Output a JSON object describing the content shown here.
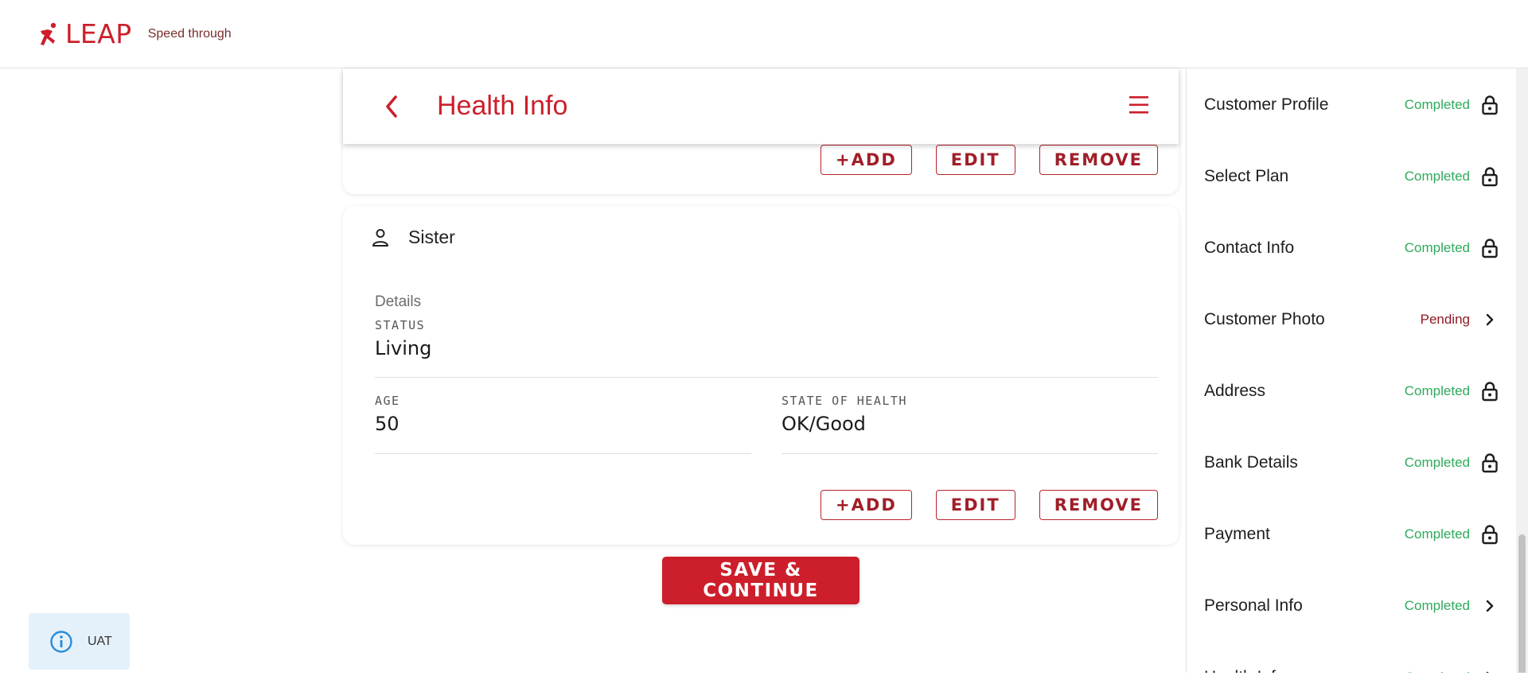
{
  "brand": {
    "name": "LEAP",
    "tagline": "Speed through",
    "color": "#cc1f2b"
  },
  "page": {
    "title": "Health Info"
  },
  "actions": {
    "add": "+ADD",
    "edit": "EDIT",
    "remove": "REMOVE",
    "save": "SAVE & CONTINUE"
  },
  "member": {
    "relation": "Sister",
    "section": "Details",
    "status_label": "STATUS",
    "status_value": "Living",
    "age_label": "AGE",
    "age_value": "50",
    "health_label": "STATE OF HEALTH",
    "health_value": "OK/Good"
  },
  "steps": [
    {
      "label": "Customer Profile",
      "status": "Completed",
      "icon": "lock-icon"
    },
    {
      "label": "Select Plan",
      "status": "Completed",
      "icon": "lock-icon"
    },
    {
      "label": "Contact Info",
      "status": "Completed",
      "icon": "lock-icon"
    },
    {
      "label": "Customer Photo",
      "status": "Pending",
      "icon": "chevron-right-icon"
    },
    {
      "label": "Address",
      "status": "Completed",
      "icon": "lock-icon"
    },
    {
      "label": "Bank Details",
      "status": "Completed",
      "icon": "lock-icon"
    },
    {
      "label": "Payment",
      "status": "Completed",
      "icon": "lock-icon"
    },
    {
      "label": "Personal Info",
      "status": "Completed",
      "icon": "chevron-right-icon"
    },
    {
      "label": "Health Info",
      "status": "Completed",
      "icon": "chevron-right-icon"
    }
  ],
  "env_badge": {
    "label": "UAT",
    "icon": "info-icon"
  },
  "colors": {
    "accent": "#cc1f2b",
    "completed": "#2eaa5c",
    "pending": "#8d1a22",
    "badge_bg": "#e4f1fb"
  }
}
